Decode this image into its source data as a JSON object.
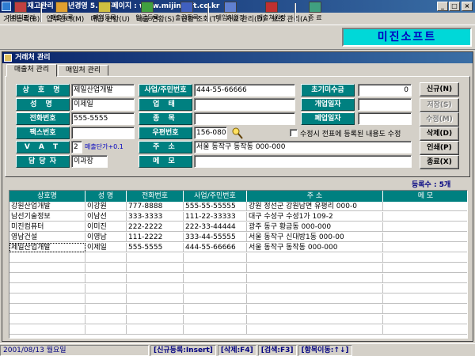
{
  "window": {
    "title": "판매재고관리 - 천년경영 5.5  홈페이지 : www.mijinsoft.co.kr"
  },
  "menu": [
    "기초등록(B)",
    "업무관리(M)",
    "매입 현황(U)",
    "매출 현황(S)",
    "현황 조회(T)",
    "자료 관리(D)",
    "보조 관리(A)"
  ],
  "toolbar": {
    "items": [
      "거래처관리",
      "매출등록",
      "매입등록",
      "입금등록",
      "출금등록",
      "매입처원장",
      "매출처원장",
      "종 료"
    ],
    "brand": "미진소프트"
  },
  "child_window": {
    "title": "거래처 관리"
  },
  "tabs": [
    "매출처 관리",
    "매입처 관리"
  ],
  "form": {
    "labels": {
      "company": "상 호 명",
      "bizno": "사업/주민번호",
      "initial_balance": "초기미수금",
      "name": "성  명",
      "business_type": "업  태",
      "open_date": "개업일자",
      "phone": "전화번호",
      "item": "종  목",
      "close_date": "폐업일자",
      "fax": "팩스번호",
      "zip": "우편번호",
      "vat": "V A T",
      "address": "주  소",
      "manager": "담 당 자",
      "memo": "메  모"
    },
    "values": {
      "company": "제일산업개발",
      "bizno": "444-55-66666",
      "initial_balance": "0",
      "name": "이제일",
      "business_type": "",
      "open_date": "",
      "phone": "555-5555",
      "item": "",
      "close_date": "",
      "fax": "",
      "zip": "156-080",
      "vat": "2",
      "vat_note": "매출단가+0.1",
      "address": "서울 동작구 동작동 000-000",
      "manager": "이과장",
      "memo": ""
    },
    "checkbox_label": "수정시 전표에 등록된 내용도 수정"
  },
  "buttons": {
    "new": "신규(N)",
    "save": "저장(S)",
    "edit": "수정(M)",
    "delete": "삭제(D)",
    "print": "인쇄(P)",
    "close": "종료(X)"
  },
  "record_count": "등록수 : 5개",
  "grid": {
    "columns": [
      "상호명",
      "성 명",
      "전화번호",
      "사업/주민번호",
      "주          소",
      "메          모"
    ],
    "rows": [
      [
        "강원산업개발",
        "이강원",
        "777-8888",
        "555-55-55555",
        "강원 정선군 강원남면 유평리 000-0",
        ""
      ],
      [
        "남선기술정보",
        "이남선",
        "333-3333",
        "111-22-33333",
        "대구 수성구 수성1가 109-2",
        ""
      ],
      [
        "미진컴퓨터",
        "이미진",
        "222-2222",
        "222-33-44444",
        "광주 동구 황금동 000-000",
        ""
      ],
      [
        "영남건설",
        "이영남",
        "111-2222",
        "333-44-55555",
        "서울 동작구 신대방1동 000-00",
        ""
      ],
      [
        "제일산업개발",
        "이제일",
        "555-5555",
        "444-55-66666",
        "서울 동작구 동작동 000-000",
        ""
      ]
    ]
  },
  "status": {
    "date": "2001/08/13 월요일",
    "hint_new": "[신규등록:Insert]",
    "hint_delete": "[삭제:F4]",
    "hint_search": "[검색:F3]",
    "hint_move": "[항목이동:↑↓]"
  }
}
